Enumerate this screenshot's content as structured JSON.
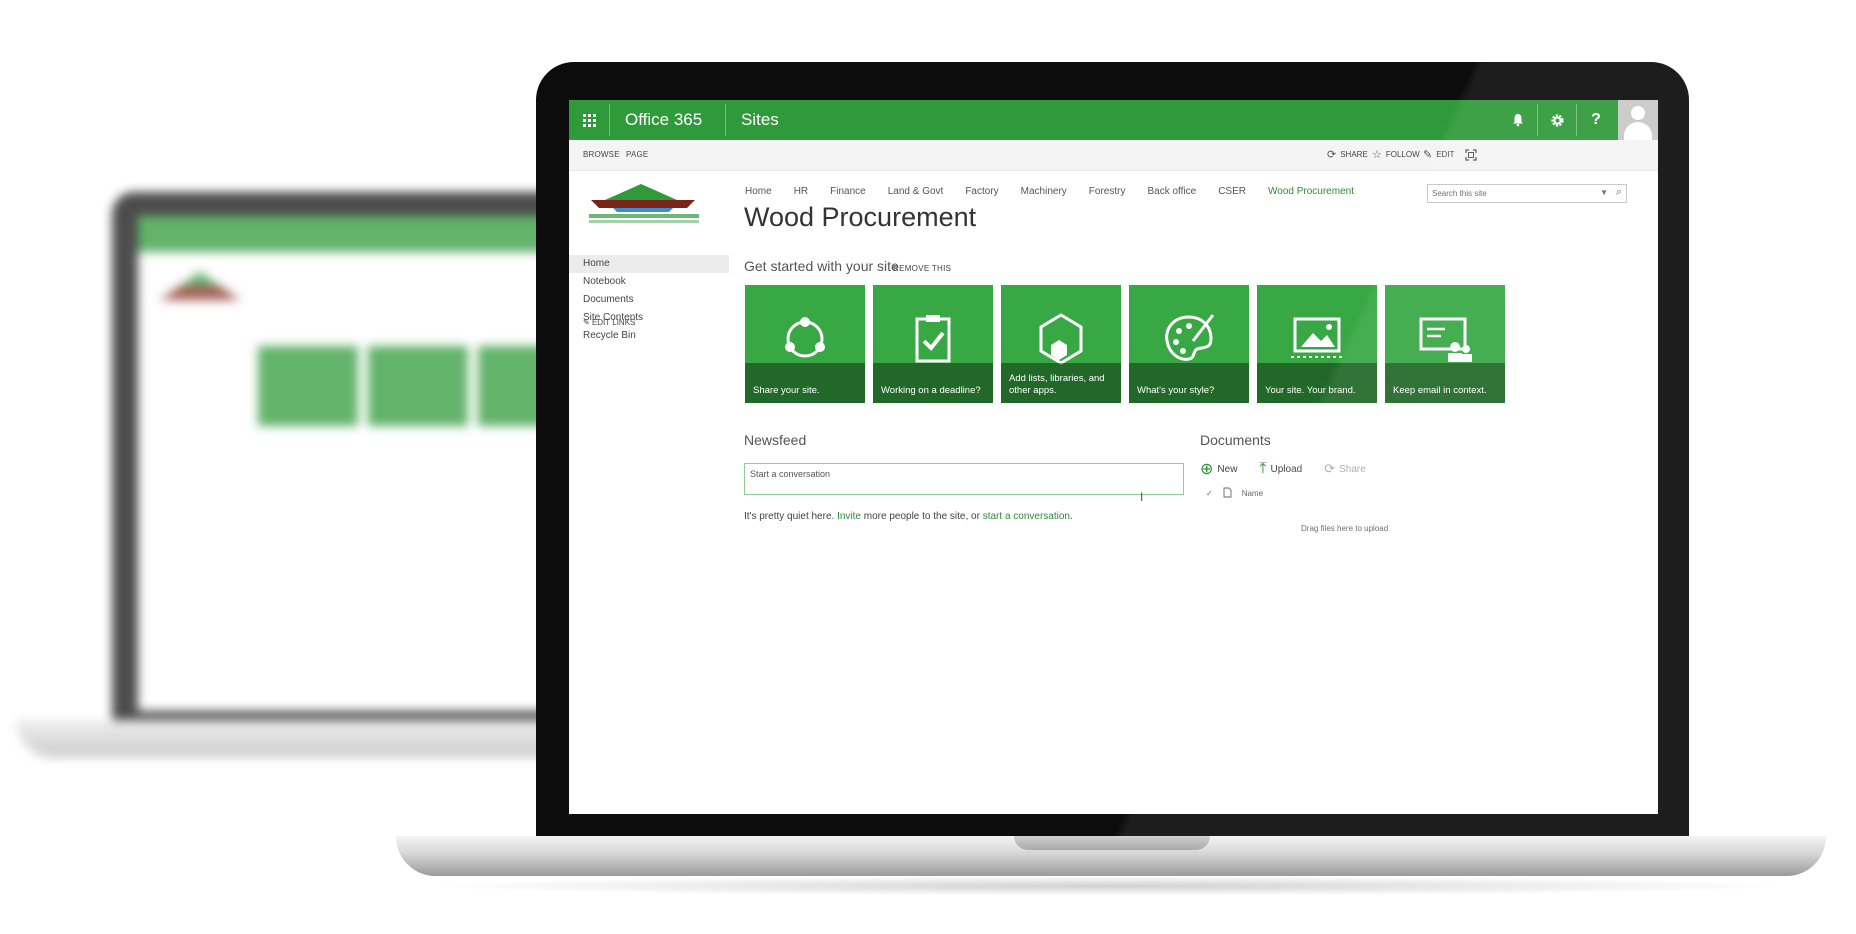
{
  "suite_bar": {
    "brand": "Office 365",
    "app": "Sites",
    "icons": [
      "waffle-icon",
      "bell-icon",
      "gear-icon",
      "help-icon",
      "avatar"
    ],
    "help_glyph": "?"
  },
  "ribbon": {
    "tabs": [
      "BROWSE",
      "PAGE"
    ],
    "actions": {
      "share": "SHARE",
      "follow": "FOLLOW",
      "edit": "EDIT"
    }
  },
  "top_nav": [
    "Home",
    "HR",
    "Finance",
    "Land & Govt",
    "Factory",
    "Machinery",
    "Forestry",
    "Back office",
    "CSER",
    "Wood Procurement"
  ],
  "page_title": "Wood Procurement",
  "search": {
    "placeholder": "Search this site"
  },
  "left_nav": {
    "items": [
      "Home",
      "Notebook",
      "Documents",
      "Site Contents",
      "Recycle Bin"
    ],
    "edit_links": "EDIT LINKS"
  },
  "get_started": {
    "title": "Get started with your site",
    "remove": "REMOVE THIS",
    "tiles": [
      {
        "label": "Share your site.",
        "icon": "share-icon"
      },
      {
        "label": "Working on a deadline?",
        "icon": "clipboard-check-icon"
      },
      {
        "label": "Add lists, libraries, and other apps.",
        "icon": "apps-hexagon-icon"
      },
      {
        "label": "What's your style?",
        "icon": "palette-icon"
      },
      {
        "label": "Your site. Your brand.",
        "icon": "picture-icon"
      },
      {
        "label": "Keep email in context.",
        "icon": "email-people-icon"
      }
    ]
  },
  "newsfeed": {
    "title": "Newsfeed",
    "placeholder": "Start a conversation",
    "quiet_1": "It's pretty quiet here. ",
    "invite": "Invite",
    "quiet_2": " more people to the site, or ",
    "start": "start a conversation",
    "quiet_3": "."
  },
  "documents": {
    "title": "Documents",
    "new": "New",
    "upload": "Upload",
    "share": "Share",
    "name_col": "Name",
    "drag": "Drag files here to upload"
  },
  "colors": {
    "suite_green": "#2f9a3a",
    "tile_green": "#37a843",
    "link_green": "#2f8b36"
  }
}
